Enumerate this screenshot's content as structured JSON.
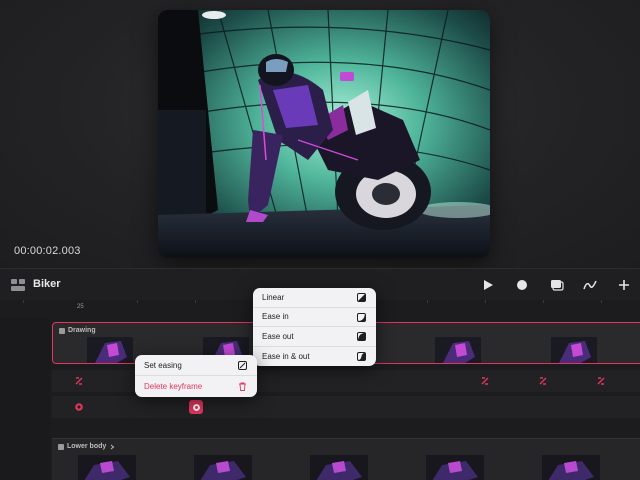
{
  "preview": {
    "timecode": "00:00:02.003"
  },
  "toolbar": {
    "project_title": "Biker",
    "buttons": [
      "play-icon",
      "record-icon",
      "onion-skin-icon",
      "draw-icon",
      "add-icon"
    ]
  },
  "ruler": {
    "current_frame_label": "25"
  },
  "tracks": {
    "drawing_label": "Drawing",
    "lower_body_label": "Lower body",
    "accent_color": "#e0365f"
  },
  "easing_menu": {
    "items": [
      {
        "label": "Linear",
        "icon": "linear-curve-icon"
      },
      {
        "label": "Ease in",
        "icon": "ease-in-curve-icon"
      },
      {
        "label": "Ease out",
        "icon": "ease-out-curve-icon"
      },
      {
        "label": "Ease in & out",
        "icon": "ease-in-out-curve-icon"
      }
    ]
  },
  "context_menu": {
    "set_easing_label": "Set easing",
    "delete_label": "Delete keyframe"
  }
}
